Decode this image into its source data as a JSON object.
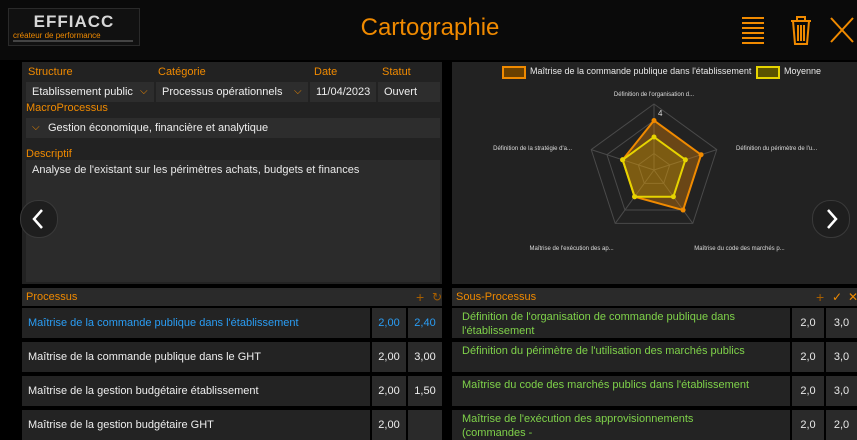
{
  "header": {
    "logo_text": "EFFIACC",
    "logo_tagline": "créateur de performance",
    "title": "Cartographie"
  },
  "colors": {
    "accent": "#f08a00",
    "series1": "#f08a00",
    "series2": "#e6d400",
    "link": "#2a9df4"
  },
  "form": {
    "structure_label": "Structure",
    "structure_value": "Etablissement public",
    "categorie_label": "Catégorie",
    "categorie_value": "Processus opérationnels",
    "date_label": "Date",
    "date_value": "11/04/2023",
    "statut_label": "Statut",
    "statut_value": "Ouvert",
    "macro_label": "MacroProcessus",
    "macro_value": "Gestion économique, financière et analytique",
    "descriptif_label": "Descriptif",
    "descriptif_value": "Analyse de l'existant sur les périmètres achats, budgets et finances"
  },
  "chart_data": {
    "type": "radar",
    "legend": [
      "Maîtrise de la commande publique dans l'établissement",
      "Moyenne"
    ],
    "axes": [
      "Définition de l'organisation d...",
      "Définition du périmètre de l'u...",
      "Maîtrise du code des marchés p...",
      "Maîtrise de l'exécution des ap...",
      "Définition de la stratégie d'a..."
    ],
    "scale_max": 4,
    "scale_label": "4",
    "series": [
      {
        "name": "Maîtrise de la commande publique dans l'établissement",
        "values": [
          3,
          3,
          3,
          2,
          2
        ]
      },
      {
        "name": "Moyenne",
        "values": [
          2,
          2,
          2,
          2,
          2
        ]
      }
    ]
  },
  "processus": {
    "title": "Processus",
    "rows": [
      {
        "label": "Maîtrise de la commande publique dans l'établissement",
        "v1": "2,00",
        "v2": "2,40",
        "selected": true
      },
      {
        "label": "Maîtrise de la commande publique dans le GHT",
        "v1": "2,00",
        "v2": "3,00"
      },
      {
        "label": "Maîtrise de la gestion budgétaire établissement",
        "v1": "2,00",
        "v2": "1,50"
      },
      {
        "label": "Maîtrise de la gestion budgétaire GHT",
        "v1": "2,00",
        "v2": ""
      }
    ]
  },
  "sous_processus": {
    "title": "Sous-Processus",
    "rows": [
      {
        "label": "Définition de l'organisation de commande publique dans l'établissement",
        "v1": "2,0",
        "v2": "3,0"
      },
      {
        "label": "Définition du périmètre de l'utilisation des marchés publics",
        "v1": "2,0",
        "v2": "3,0"
      },
      {
        "label": "Maîtrise du code des marchés publics dans l'établissement",
        "v1": "2,0",
        "v2": "3,0"
      },
      {
        "label": "Maîtrise de l'exécution des approvisionnements (commandes -",
        "v1": "2,0",
        "v2": "2,0"
      }
    ]
  }
}
